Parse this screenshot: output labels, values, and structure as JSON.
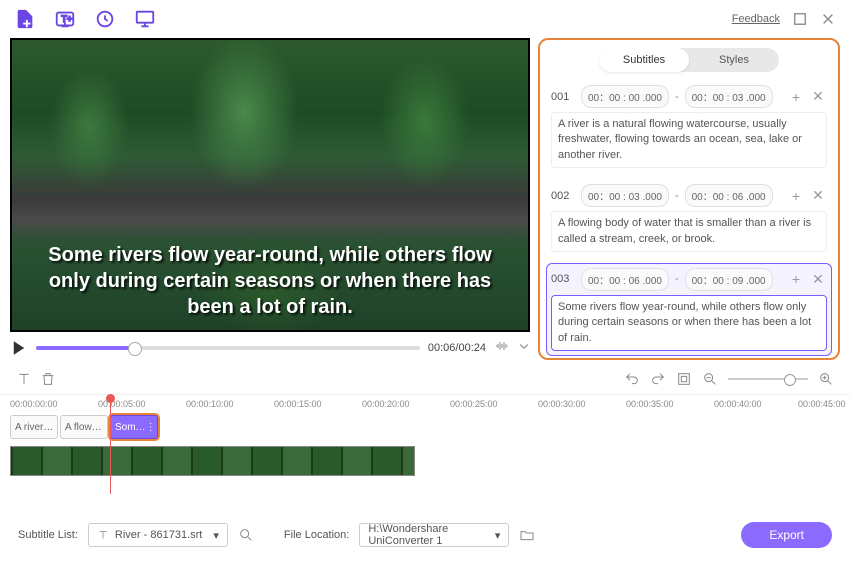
{
  "toolbar": {
    "feedback": "Feedback"
  },
  "player": {
    "subtitle_overlay": "Some rivers flow year-round, while others flow only during certain seasons or when there has been a lot of rain.",
    "time": "00:06/00:24"
  },
  "tabs": {
    "subtitles": "Subtitles",
    "styles": "Styles"
  },
  "subtitles": {
    "entries": [
      {
        "num": "001",
        "start": "00：00 : 00 .000",
        "end": "00：00 : 03 .000",
        "text": "A river is a natural flowing watercourse, usually freshwater, flowing towards an ocean, sea, lake or another river."
      },
      {
        "num": "002",
        "start": "00：00 : 03 .000",
        "end": "00：00 : 06 .000",
        "text": " A flowing body of water that is smaller than a river is called a stream, creek, or brook."
      },
      {
        "num": "003",
        "start": "00：00 : 06 .000",
        "end": "00：00 : 09 .000",
        "text": "Some rivers flow year-round, while others flow only during certain seasons or when there has been a lot of rain."
      }
    ]
  },
  "ruler": {
    "ticks": [
      "00:00:00:00",
      "00:00:05:00",
      "00:00:10:00",
      "00:00:15:00",
      "00:00:20:00",
      "00:00:25:00",
      "00:00:30:00",
      "00:00:35:00",
      "00:00:40:00",
      "00:00:45:00"
    ]
  },
  "clips": {
    "c1": "A river…",
    "c2": "A flow…",
    "c3": "Som…"
  },
  "footer": {
    "subtitle_list_label": "Subtitle List:",
    "subtitle_file": "River - 861731.srt",
    "file_location_label": "File Location:",
    "file_location": "H:\\Wondershare UniConverter 1",
    "export": "Export"
  }
}
